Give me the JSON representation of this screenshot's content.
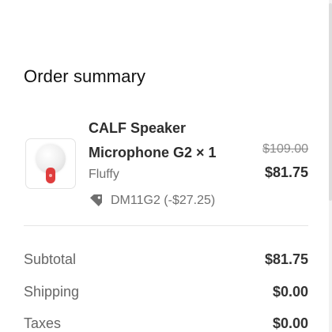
{
  "order_summary": {
    "title": "Order summary",
    "item": {
      "name": "CALF Speaker Microphone G2 × 1",
      "variant": "Fluffy",
      "original_price": "$109.00",
      "sale_price": "$81.75",
      "discount": "DM11G2 (-$27.25)",
      "image_icon": "microphone-image",
      "discount_icon": "tag-icon"
    },
    "totals": {
      "subtotal_label": "Subtotal",
      "subtotal_value": "$81.75",
      "shipping_label": "Shipping",
      "shipping_value": "$0.00",
      "taxes_label": "Taxes",
      "taxes_value": "$0.00"
    }
  },
  "colors": {
    "text_primary": "#2d2d2d",
    "text_secondary": "#707070",
    "mic_red": "#df3d3d",
    "divider": "#e5e5e5"
  }
}
